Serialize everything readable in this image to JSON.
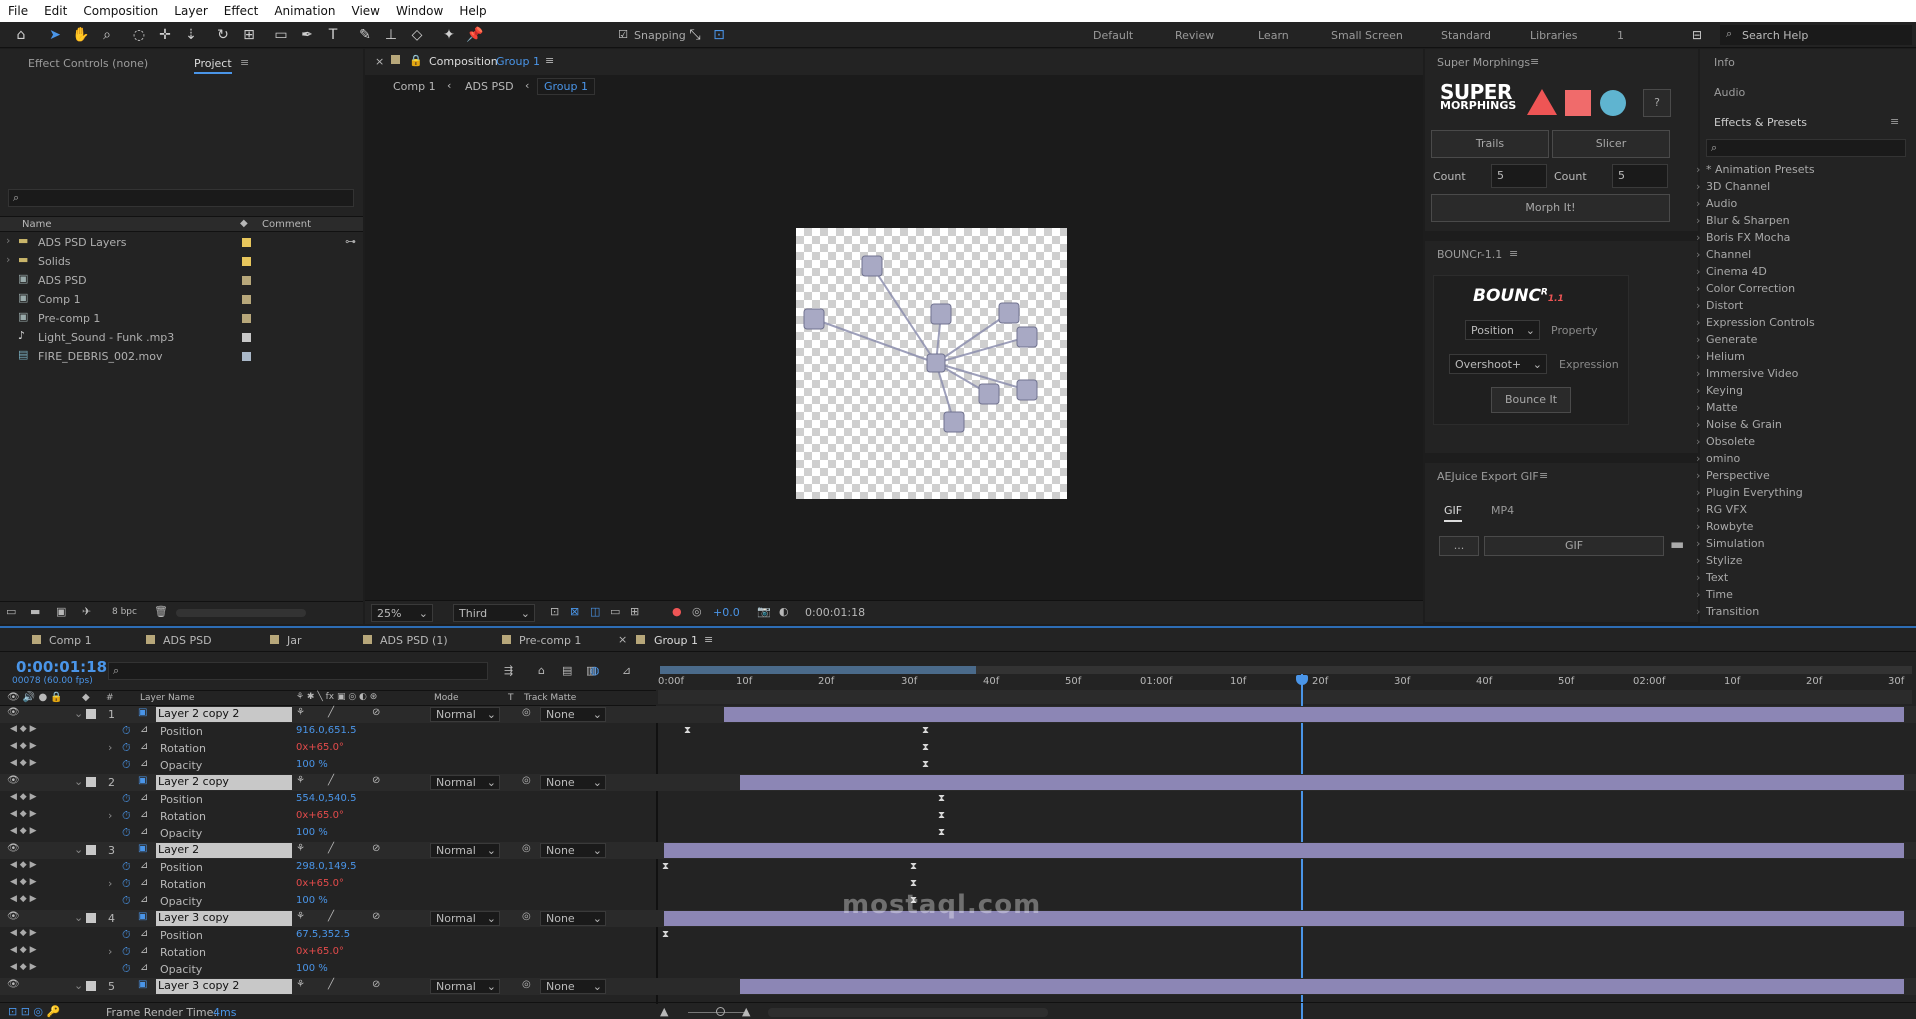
{
  "menu": [
    "File",
    "Edit",
    "Composition",
    "Layer",
    "Effect",
    "Animation",
    "View",
    "Window",
    "Help"
  ],
  "toolbar": {
    "snapping": "Snapping",
    "search_placeholder": "Search Help",
    "workspaces": [
      "Default",
      "Review",
      "Learn",
      "Small Screen",
      "Standard",
      "Libraries",
      "1"
    ]
  },
  "left_panel": {
    "tab_effect": "Effect Controls (none)",
    "tab_project": "Project",
    "col_name": "Name",
    "col_comment": "Comment",
    "bpc": "8 bpc",
    "items": [
      "ADS PSD Layers",
      "Solids",
      "ADS PSD",
      "Comp 1",
      "Pre-comp 1",
      "Light_Sound - Funk .mp3",
      "FIRE_DEBRIS_002.mov"
    ]
  },
  "comp": {
    "title": "Composition",
    "title_link": "Group 1",
    "crumbs": [
      "Comp 1",
      "ADS PSD",
      "Group 1"
    ],
    "zoom": "25%",
    "resolution": "Third",
    "exposure": "+0.0",
    "time": "0:00:01:18"
  },
  "super_morph": {
    "title": "Super Morphings",
    "logo1": "SUPER",
    "logo2": "MORPHINGS",
    "help": "?",
    "trails": "Trails",
    "slicer": "Slicer",
    "count_label": "Count",
    "count1": "5",
    "count2": "5",
    "morph": "Morph It!"
  },
  "bouncr": {
    "title": "BOUNCr-1.1",
    "logo": "BOUNC",
    "logo_sup": "R",
    "version": "1.1",
    "property_val": "Position",
    "property_lbl": "Property",
    "expr_val": "Overshoot+",
    "expr_lbl": "Expression",
    "button": "Bounce It"
  },
  "aejuice": {
    "title": "AEJuice Export GIF",
    "tab_gif": "GIF",
    "tab_mp4": "MP4",
    "dots": "...",
    "gif_btn": "GIF"
  },
  "right_panel": {
    "info": "Info",
    "audio": "Audio",
    "effects": "Effects & Presets",
    "categories": [
      "* Animation Presets",
      "3D Channel",
      "Audio",
      "Blur & Sharpen",
      "Boris FX Mocha",
      "Channel",
      "Cinema 4D",
      "Color Correction",
      "Distort",
      "Expression Controls",
      "Generate",
      "Helium",
      "Immersive Video",
      "Keying",
      "Matte",
      "Noise & Grain",
      "Obsolete",
      "omino",
      "Perspective",
      "Plugin Everything",
      "RG VFX",
      "Rowbyte",
      "Simulation",
      "Stylize",
      "Text",
      "Time",
      "Transition"
    ]
  },
  "timeline": {
    "tabs": [
      "Comp 1",
      "ADS PSD",
      "Jar",
      "ADS PSD (1)",
      "Pre-comp 1",
      "Group 1"
    ],
    "timecode": "0:00:01:18",
    "frames": "00078 (60.00 fps)",
    "cols": {
      "layer_name": "Layer Name",
      "mode": "Mode",
      "t": "T",
      "track_matte": "Track Matte",
      "num": "#"
    },
    "ruler": [
      "0:00f",
      "10f",
      "20f",
      "30f",
      "40f",
      "50f",
      "01:00f",
      "10f",
      "20f",
      "30f",
      "40f",
      "50f",
      "02:00f",
      "10f",
      "20f",
      "30f"
    ],
    "mode": "Normal",
    "matte": "None",
    "layers": [
      {
        "num": "1",
        "name": "Layer 2 copy 2",
        "pos": "916.0,651.5",
        "rot": "0x+65.0°",
        "op": "100",
        "pct": "%"
      },
      {
        "num": "2",
        "name": "Layer 2 copy",
        "pos": "554.0,540.5",
        "rot": "0x+65.0°",
        "op": "100",
        "pct": "%"
      },
      {
        "num": "3",
        "name": "Layer 2",
        "pos": "298.0,149.5",
        "rot": "0x+65.0°",
        "op": "100",
        "pct": "%"
      },
      {
        "num": "4",
        "name": "Layer 3 copy",
        "pos": "67.5,352.5",
        "rot": "0x+65.0°",
        "op": "100",
        "pct": "%"
      },
      {
        "num": "5",
        "name": "Layer 3 copy 2"
      }
    ],
    "props": [
      "Position",
      "Rotation",
      "Opacity"
    ],
    "render_label": "Frame Render Time:",
    "render_val": "4ms"
  },
  "watermark": "mostaql.com"
}
